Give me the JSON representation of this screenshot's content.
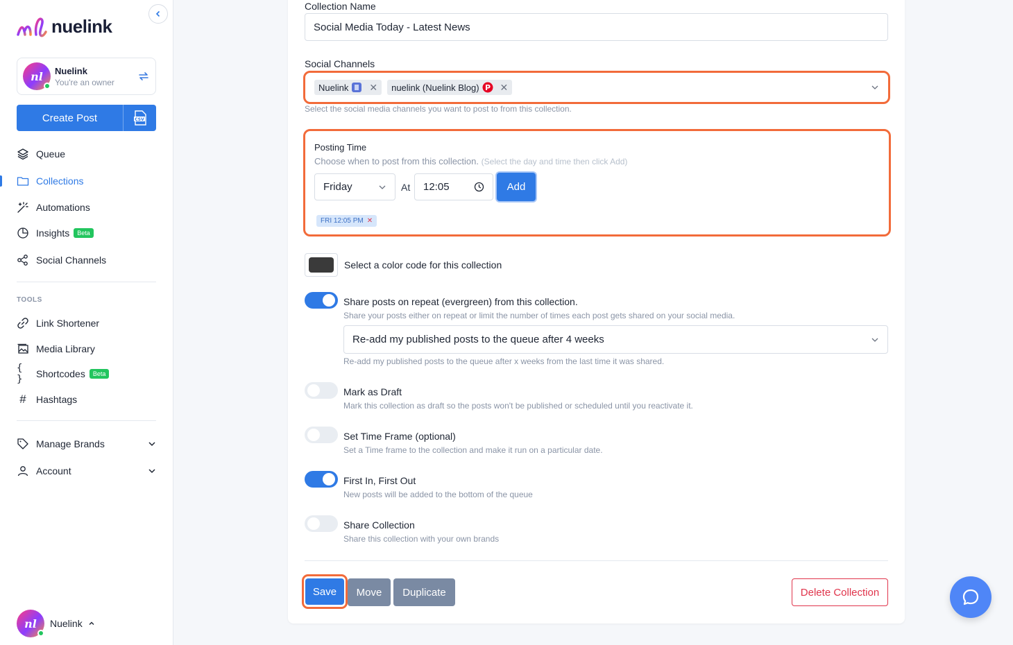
{
  "sidebar": {
    "logo_text": "nuelink",
    "account": {
      "name": "Nuelink",
      "role": "You're an owner"
    },
    "create_post_label": "Create Post",
    "nav": [
      {
        "label": "Queue",
        "icon": "layers-icon"
      },
      {
        "label": "Collections",
        "icon": "folder-icon",
        "active": true
      },
      {
        "label": "Automations",
        "icon": "magic-wand-icon"
      },
      {
        "label": "Insights",
        "icon": "pie-chart-icon",
        "badge": "Beta"
      },
      {
        "label": "Social Channels",
        "icon": "share-icon"
      }
    ],
    "tools_label": "TOOLS",
    "tools": [
      {
        "label": "Link Shortener",
        "icon": "link-icon"
      },
      {
        "label": "Media Library",
        "icon": "image-icon"
      },
      {
        "label": "Shortcodes",
        "icon": "braces-icon",
        "badge": "Beta"
      },
      {
        "label": "Hashtags",
        "icon": "hash-icon"
      }
    ],
    "bottom_nav": [
      {
        "label": "Manage Brands",
        "icon": "tag-icon"
      },
      {
        "label": "Account",
        "icon": "user-icon"
      }
    ],
    "bottom_user": "Nuelink"
  },
  "form": {
    "collection_name_label": "Collection Name",
    "collection_name_value": "Social Media Today - Latest News",
    "social_channels_label": "Social Channels",
    "channels": [
      {
        "name": "Nuelink",
        "icon": "linkedin-page-icon"
      },
      {
        "name": "nuelink (Nuelink Blog)",
        "icon": "pinterest-icon"
      }
    ],
    "social_channels_help": "Select the social media channels you want to post to from this collection.",
    "posting_time_label": "Posting Time",
    "posting_time_help": "Choose when to post from this collection.",
    "posting_time_hint": "(Select the day and time then click Add)",
    "day_value": "Friday",
    "at_label": "At",
    "time_value": "12:05",
    "add_label": "Add",
    "time_slots": [
      "FRI 12:05 PM"
    ],
    "color_label": "Select a color code for this collection",
    "color_value": "#3a3a3a",
    "repeat_label": "Share posts on repeat (evergreen) from this collection.",
    "repeat_help": "Share your posts either on repeat or limit the number of times each post gets shared on your social media.",
    "repeat_select_value": "Re-add my published posts to the queue after 4 weeks",
    "repeat_select_help": "Re-add my published posts to the queue after x weeks from the last time it was shared.",
    "draft_label": "Mark as Draft",
    "draft_help": "Mark this collection as draft so the posts won't be published or scheduled until you reactivate it.",
    "timeframe_label": "Set Time Frame (optional)",
    "timeframe_help": "Set a Time frame to the collection and make it run on a particular date.",
    "fifo_label": "First In, First Out",
    "fifo_help": "New posts will be added to the bottom of the queue",
    "share_label": "Share Collection",
    "share_help": "Share this collection with your own brands",
    "toggles": {
      "repeat": true,
      "draft": false,
      "timeframe": false,
      "fifo": true,
      "share": false
    }
  },
  "actions": {
    "save": "Save",
    "move": "Move",
    "duplicate": "Duplicate",
    "delete": "Delete Collection"
  },
  "colors": {
    "accent": "#2f7ae5",
    "highlight": "#f26b3a",
    "danger": "#e0344b",
    "success": "#22c55e"
  }
}
